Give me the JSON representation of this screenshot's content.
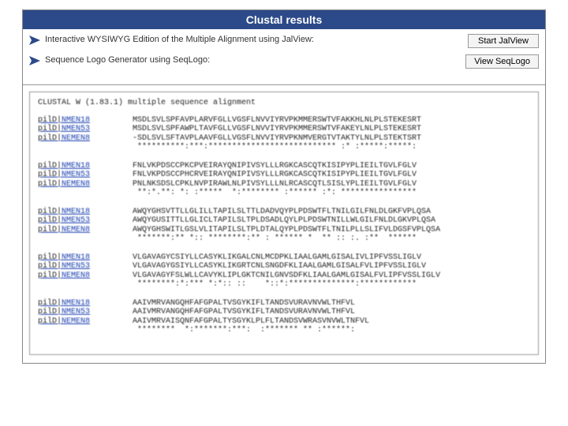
{
  "header": {
    "title": "Clustal results"
  },
  "tools": {
    "row1": {
      "text": "Interactive WYSIWYG Edition of the Multiple Alignment using JalView:",
      "button": "Start JalView"
    },
    "row2": {
      "text": "Sequence Logo Generator using SeqLogo:",
      "button": "View SeqLogo"
    }
  },
  "alignment": {
    "header_line": "CLUSTAL W (1.83.1) multiple sequence alignment",
    "id_prefix": "pilD|",
    "blocks": [
      {
        "rows": [
          {
            "id": "NMEN18",
            "seq": "MSDLSVLSPFAVPLARVFGLLVGSFLNVVIYRVPKMMERSWTVFAKKHLNLPLSTEKESRT"
          },
          {
            "id": "NMEN53",
            "seq": "MSDLSVLSPFAWPLTAVFGLLVGSFLNVVIYRVPKMMERSWTVFAKEYLNLPLSTEKESRT"
          },
          {
            "id": "NEMEN8",
            "seq": "-SDLSVLSFTAVPLAAVFGLLVGSFLNVVIYRVPKNMVERGTVTAKTYLNLPLSTEKTSRT"
          }
        ],
        "consensus": " **********:***:*************************** :* :*****:*****:"
      },
      {
        "rows": [
          {
            "id": "NMEN18",
            "seq": "FNLVKPDSCCPKCPVEIRAYQNIPIVSYLLLRGKCASCQTKISIPYPLIEILTGVLFGLV"
          },
          {
            "id": "NMEN53",
            "seq": "FNLVKPDSCCPHCRVEIRAYQNIPIVSYLLLRGKCASCQTKISIPYPLIEILTGVLFGLV"
          },
          {
            "id": "NEMEN8",
            "seq": "PNLNKSDSLCPKLNVPIRAWLNLPIVSYLLLNLRCASCQTLSISLYPLIEILTGVLFGLV"
          }
        ],
        "consensus": " **:*.**: *: :*****  *:******** :****** :*: ****************"
      },
      {
        "rows": [
          {
            "id": "NMEN18",
            "seq": "AWQYGHSVTTLLGLILLTAPILSLTTLDADVQYPLPDSWTFLTNILGILFNLDLGKFVPLQSA"
          },
          {
            "id": "NMEN53",
            "seq": "AWQYGUSITTLLGLICLTAPILSLTPLDSADLQYLPLPDSWTNILLWLGILFNLDLGKVPLQSA"
          },
          {
            "id": "NEMEN8",
            "seq": "AWQYGHSWITLGSLVLITAPILSLTPLDTALQYPLPDSWTFLTNILPLLSLIFVLDGSFVPLQSA"
          }
        ],
        "consensus": " *******:** *:: ********:** : ****** *  ** :: :. :**  ******"
      },
      {
        "rows": [
          {
            "id": "NMEN18",
            "seq": "VLGAVAGYCSIYLLCASYKLIKGALCNLMCDPKLIAALGAMLGISALIVLIPFVSSLIGLV"
          },
          {
            "id": "NMEN53",
            "seq": "VLGAVAGYGSIYLLCASYKLIKGRTCNLSNGDFKLIAALGAMLGISALFVLIPFVSSLIGLV"
          },
          {
            "id": "NEMEN8",
            "seq": "VLGAVAGYFSLWLLCAVYKLIPLGKTCNILGNVSDFKLIAALGAMLGISALFVLIPFVSSLIGLV"
          }
        ],
        "consensus": " ********:*:*** *:*:: ::    *::*:**************:************"
      },
      {
        "rows": [
          {
            "id": "NMEN18",
            "seq": "AAIVMRVANGQHFAFGPALTVSGYKIFLTANDSVURAVNVWLTHFVL"
          },
          {
            "id": "NMEN53",
            "seq": "AAIVMRVANGQHFAFGPALTVSGYKIFLTANDSVURAVNVWLTHFVL"
          },
          {
            "id": "NEMEN8",
            "seq": "AAIVMRVAISQNFAFGPALTYSGYKLPLFLTANDSVWRASVNVWLTNFVL"
          }
        ],
        "consensus": " ********  *:*******:***:  :******* ** :******:"
      }
    ]
  }
}
